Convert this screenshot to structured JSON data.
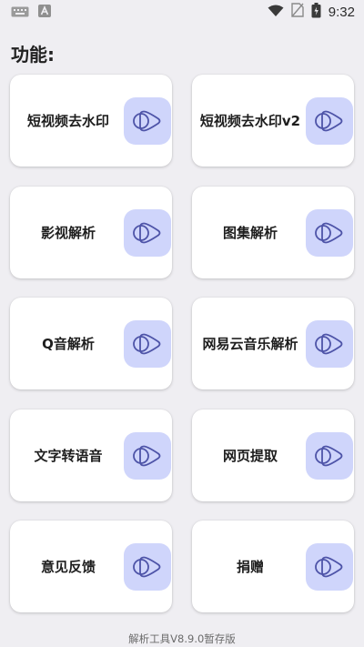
{
  "status_bar": {
    "time": "9:32",
    "icons": [
      "keyboard-icon",
      "a-notification-icon",
      "wifi-icon",
      "no-sim-icon",
      "battery-icon"
    ]
  },
  "section_title": "功能:",
  "cards": [
    {
      "label": "短视频去水印",
      "icon": "play-logo-icon"
    },
    {
      "label": "短视频去水印v2",
      "icon": "play-logo-icon"
    },
    {
      "label": "影视解析",
      "icon": "play-logo-icon"
    },
    {
      "label": "图集解析",
      "icon": "play-logo-icon"
    },
    {
      "label": "Q音解析",
      "icon": "play-logo-icon"
    },
    {
      "label": "网易云音乐解析",
      "icon": "play-logo-icon"
    },
    {
      "label": "文字转语音",
      "icon": "play-logo-icon"
    },
    {
      "label": "网页提取",
      "icon": "play-logo-icon"
    },
    {
      "label": "意见反馈",
      "icon": "play-logo-icon"
    },
    {
      "label": "捐赠",
      "icon": "play-logo-icon"
    }
  ],
  "footer": "解析工具V8.9.0暂存版",
  "colors": {
    "background": "#efeef2",
    "card": "#ffffff",
    "icon_bg": "#cfd5fb",
    "icon_stroke": "#4e54a8"
  }
}
